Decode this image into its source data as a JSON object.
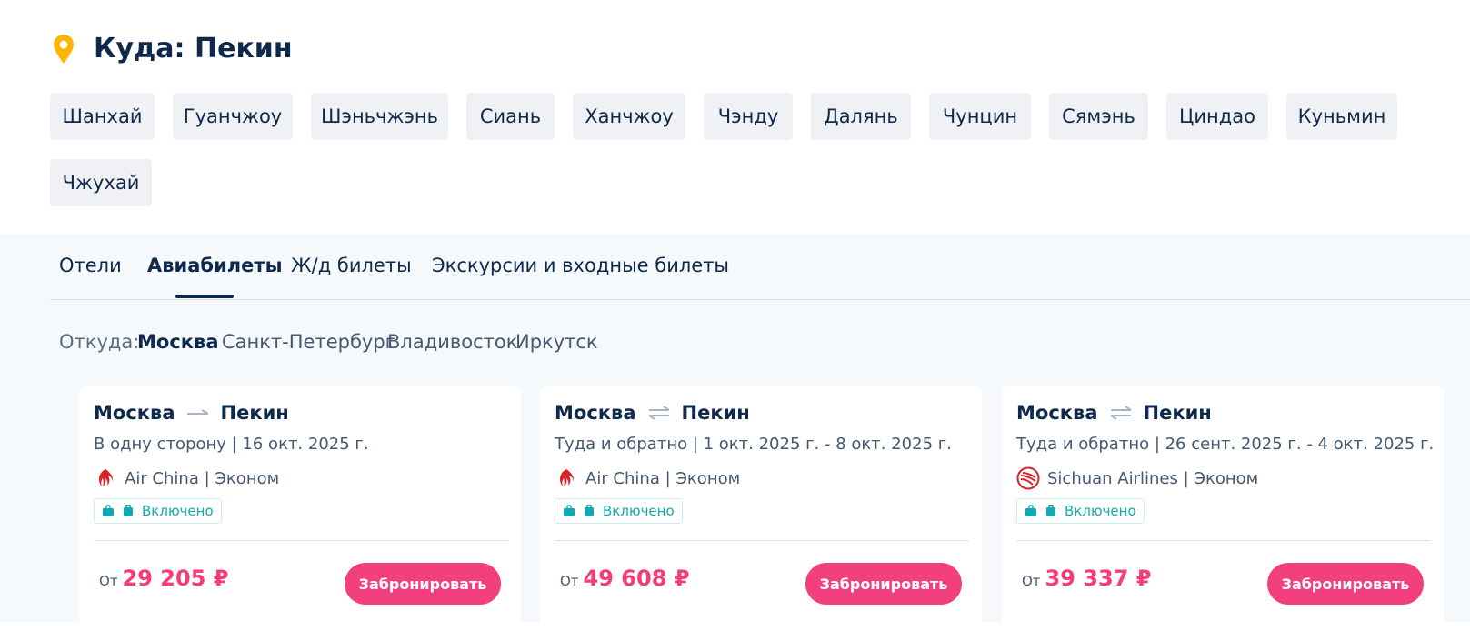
{
  "destination": {
    "label": "Куда: Пекин",
    "icon": "location-pin-icon",
    "icon_color": "#ffb400"
  },
  "city_chips": [
    "Шанхай",
    "Гуанчжоу",
    "Шэньчжэнь",
    "Сиань",
    "Ханчжоу",
    "Чэнду",
    "Далянь",
    "Чунцин",
    "Сямэнь",
    "Циндао",
    "Куньмин",
    "Чжухай"
  ],
  "tabs": [
    {
      "label": "Отели",
      "active": false
    },
    {
      "label": "Авиабилеты",
      "active": true
    },
    {
      "label": "Ж/д билеты",
      "active": false
    },
    {
      "label": "Экскурсии и входные билеты",
      "active": false
    }
  ],
  "origin_filter": {
    "label": "Откуда:",
    "cities": [
      {
        "label": "Москва",
        "active": true
      },
      {
        "label": "Санкт-Петербург",
        "active": false
      },
      {
        "label": "Владивосток",
        "active": false
      },
      {
        "label": "Иркутск",
        "active": false
      }
    ]
  },
  "flights": [
    {
      "from": "Москва",
      "to": "Пекин",
      "trip": "one-way",
      "dates": "В одну сторону | 16 окт. 2025 г.",
      "airline": "Air China | Эконом",
      "airline_logo": "air-china-logo-icon",
      "baggage": "Включено",
      "price_prefix": "От",
      "price": "29 205 ₽",
      "book_label": "Забронировать"
    },
    {
      "from": "Москва",
      "to": "Пекин",
      "trip": "round-trip",
      "dates": "Туда и обратно | 1 окт. 2025 г. - 8 окт. 2025 г.",
      "airline": "Air China | Эконом",
      "airline_logo": "air-china-logo-icon",
      "baggage": "Включено",
      "price_prefix": "От",
      "price": "49 608 ₽",
      "book_label": "Забронировать"
    },
    {
      "from": "Москва",
      "to": "Пекин",
      "trip": "round-trip",
      "dates": "Туда и обратно | 26 сент. 2025 г. - 4 окт. 2025 г.",
      "airline": "Sichuan Airlines | Эконом",
      "airline_logo": "sichuan-airlines-logo-icon",
      "baggage": "Включено",
      "price_prefix": "От",
      "price": "39 337 ₽",
      "book_label": "Забронировать"
    }
  ],
  "colors": {
    "text_primary": "#0f294d",
    "chip_bg": "#eff1f5",
    "price": "#f43d77",
    "book_button": "#f23f7e",
    "baggage": "#14a8b4",
    "panel_bg": "#f6f9fc"
  }
}
